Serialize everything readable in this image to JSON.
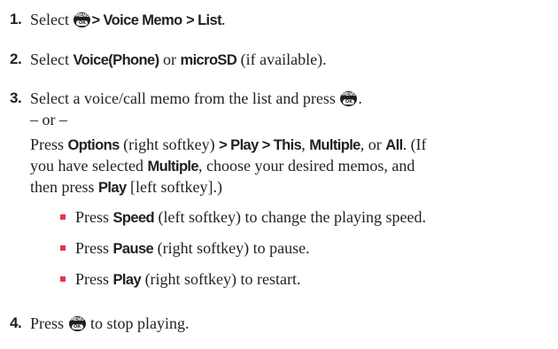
{
  "menu_key": {
    "icon": "menu-ok-key-icon",
    "top_text": "MENU",
    "bottom_text": "OK"
  },
  "bullet_color": "#e2374f",
  "steps": [
    {
      "number": "1.",
      "select": "Select",
      "path_voice_memo": "> Voice Memo",
      "path_list": "> List",
      "end": "."
    },
    {
      "number": "2.",
      "select": "Select",
      "voice_phone": "Voice(Phone)",
      "or": "or",
      "microsd": "microSD",
      "tail": "(if available)."
    },
    {
      "number": "3.",
      "text_a": "Select a voice/call memo from the list and press",
      "end": ".",
      "or_line": "– or –",
      "press": "Press",
      "options": "Options",
      "right_softkey": "(right softkey)",
      "play_path": "> Play > This",
      "comma": ",",
      "multiple": "Multiple",
      "comma_or": ", or",
      "all": "All",
      "if_text": ". (If",
      "line3a": "you have selected",
      "multiple2": "Multiple",
      "line3b": ", choose your desired memos, and",
      "line4a": "then press",
      "play": "Play",
      "line4b": "[left softkey].)",
      "bullets": [
        {
          "press": "Press",
          "key": "Speed",
          "rest": "(left softkey) to change the playing speed."
        },
        {
          "press": "Press",
          "key": "Pause",
          "rest": "(right softkey) to pause."
        },
        {
          "press": "Press",
          "key": "Play",
          "rest": "(right softkey) to restart."
        }
      ]
    },
    {
      "number": "4.",
      "press": "Press",
      "rest": "to stop playing."
    }
  ]
}
